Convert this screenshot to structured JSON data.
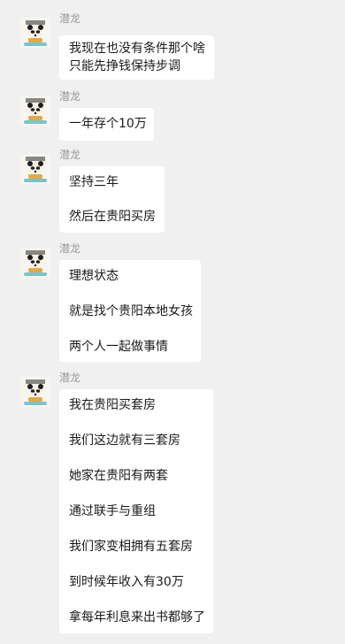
{
  "theme": {
    "background": "#f0f0f0",
    "bubble": "#ffffff",
    "sender_color": "#9a9a9a",
    "text_color": "#1a1a1a"
  },
  "avatar_icon": "cartoon-panda-avatar-icon",
  "messages": [
    {
      "sender": "潜龙",
      "lines": [
        "我现在也没有条件那个啥",
        "只能先挣钱保持步调"
      ]
    },
    {
      "sender": "潜龙",
      "lines": [
        "一年存个10万"
      ]
    },
    {
      "sender": "潜龙",
      "lines": [
        "坚持三年",
        "然后在贵阳买房"
      ]
    },
    {
      "sender": "潜龙",
      "lines": [
        "理想状态",
        "就是找个贵阳本地女孩",
        "两个人一起做事情"
      ]
    },
    {
      "sender": "潜龙",
      "lines": [
        "我在贵阳买套房",
        "我们这边就有三套房",
        "她家在贵阳有两套",
        "通过联手与重组",
        "我们家变相拥有五套房",
        "到时候年收入有30万",
        "拿每年利息来出书都够了"
      ]
    }
  ]
}
